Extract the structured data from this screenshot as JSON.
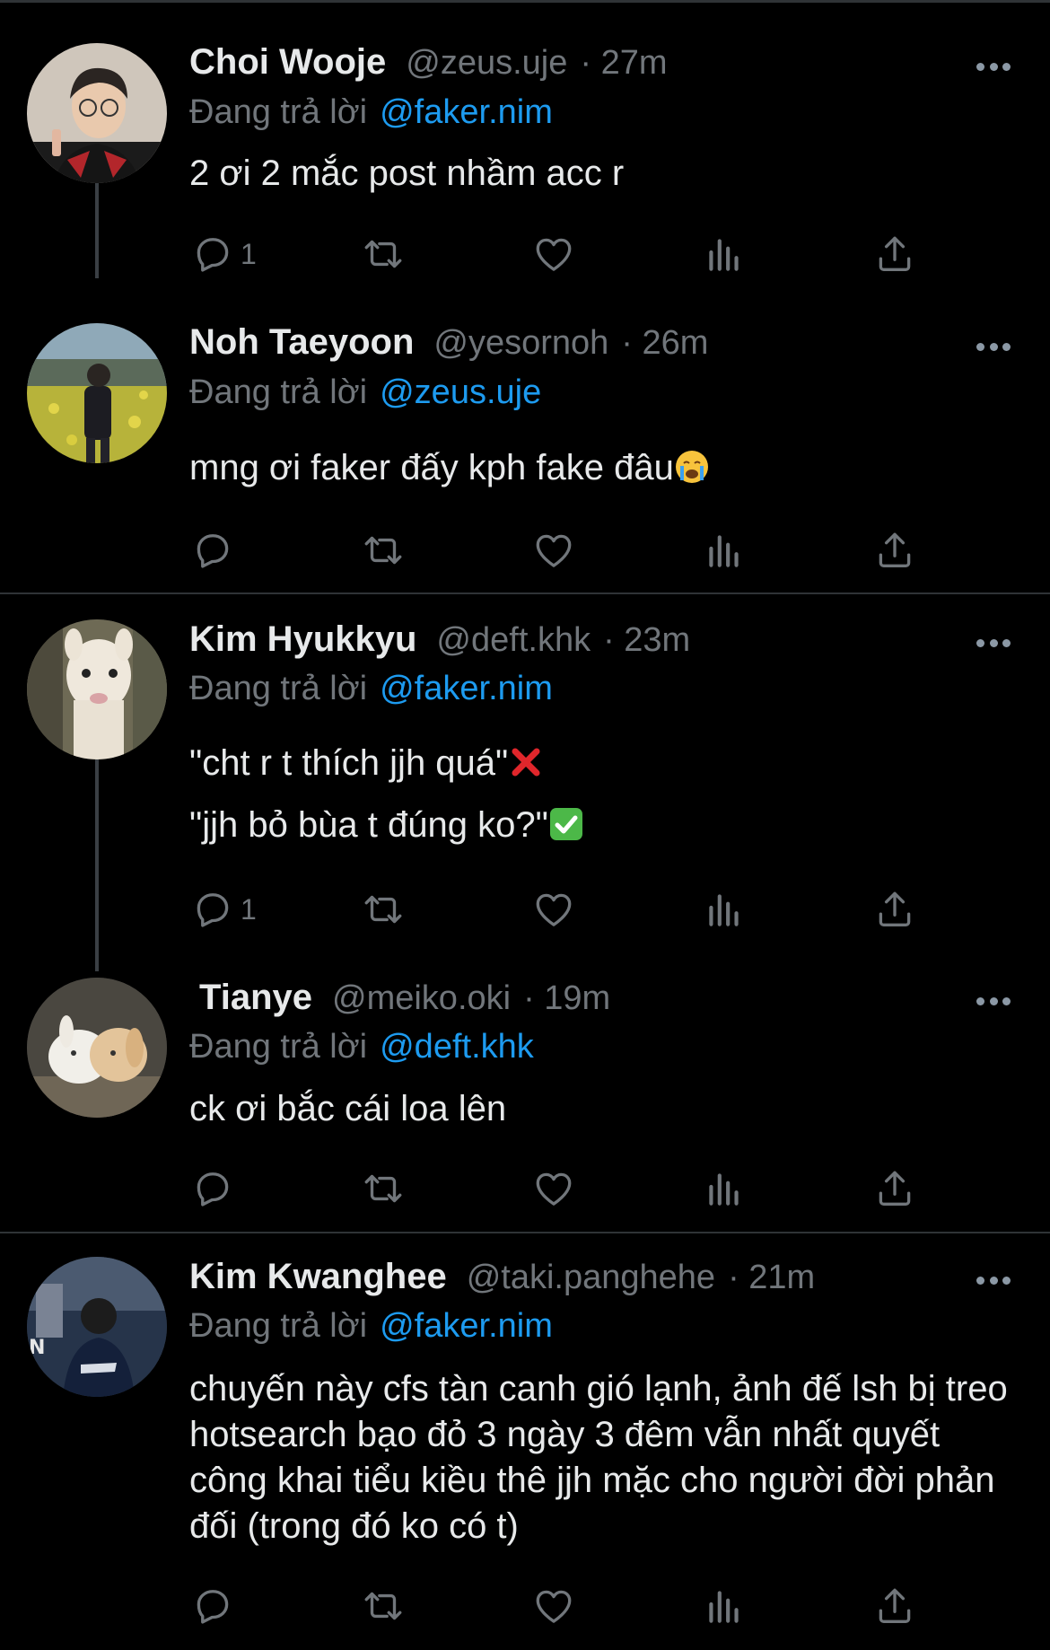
{
  "reply_prefix": "Đang trả lời",
  "tweets": [
    {
      "name": "Choi Wooje",
      "handle": "@zeus.uje",
      "time": "· 27m",
      "reply_to": "@faker.nim",
      "lines": [
        "2 ơi 2 mắc post nhầm acc r"
      ],
      "reply_count": "1"
    },
    {
      "name": "Noh Taeyoon",
      "handle": "@yesornoh",
      "time": "· 26m",
      "reply_to": "@zeus.uje",
      "lines": [
        "mng ơi faker đấy kph fake đâu"
      ],
      "reply_count": ""
    },
    {
      "name": "Kim Hyukkyu",
      "handle": "@deft.khk",
      "time": "· 23m",
      "reply_to": "@faker.nim",
      "lines": [
        "\"cht r t thích jjh quá\"",
        "\"jjh bỏ bùa t đúng ko?\""
      ],
      "reply_count": "1"
    },
    {
      "name": "Tianye",
      "handle": "@meiko.oki",
      "time": "· 19m",
      "reply_to": "@deft.khk",
      "lines": [
        "ck ơi bắc cái loa lên"
      ],
      "reply_count": ""
    },
    {
      "name": "Kim Kwanghee",
      "handle": "@taki.panghehe",
      "time": "· 21m",
      "reply_to": "@faker.nim",
      "lines": [
        "chuyến này cfs tàn canh gió lạnh, ảnh đế lsh bị treo hotsearch bạo đỏ 3 ngày 3 đêm vẫn nhất quyết công khai tiểu kiều thê jjh mặc cho người đời phản đối (trong đó ko có t)"
      ],
      "reply_count": ""
    }
  ],
  "colors": {
    "background": "#000000",
    "text": "#e7e9ea",
    "muted": "#71767b",
    "link": "#1d9bf0",
    "divider": "#2f3336"
  },
  "icons": [
    "reply-icon",
    "retweet-icon",
    "like-icon",
    "views-icon",
    "share-icon",
    "more-icon"
  ]
}
